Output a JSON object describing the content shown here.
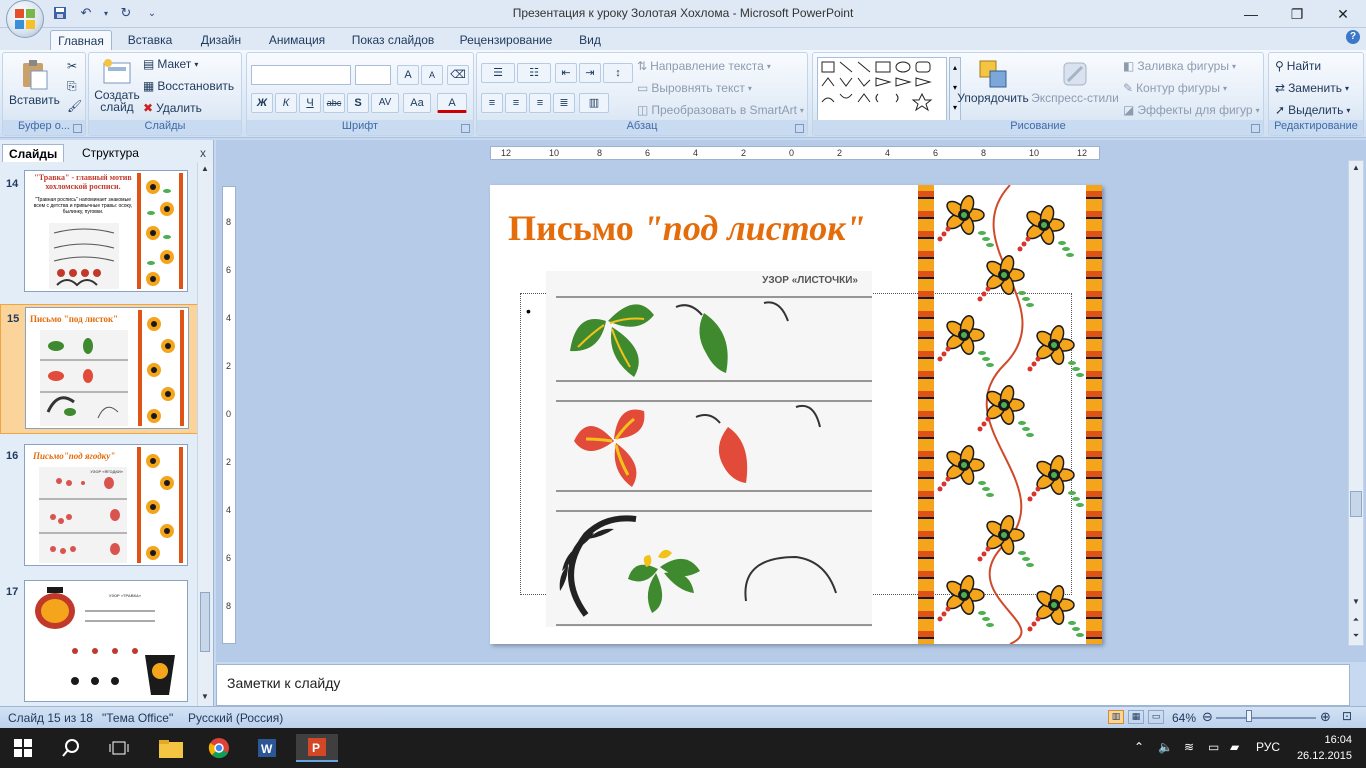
{
  "window": {
    "title": "Презентация к уроку Золотая Хохлома - Microsoft PowerPoint",
    "minimize": "—",
    "maximize": "❐",
    "close": "✕"
  },
  "qat": {
    "save_icon": "save-icon",
    "undo_icon": "undo-icon",
    "redo_icon": "redo-icon"
  },
  "tabs": [
    {
      "label": "Главная",
      "active": true
    },
    {
      "label": "Вставка"
    },
    {
      "label": "Дизайн"
    },
    {
      "label": "Анимация"
    },
    {
      "label": "Показ слайдов"
    },
    {
      "label": "Рецензирование"
    },
    {
      "label": "Вид"
    }
  ],
  "ribbon": {
    "clipboard": {
      "label": "Буфер о...",
      "paste": "Вставить"
    },
    "slides": {
      "label": "Слайды",
      "new_slide": "Создать слайд",
      "layout": "Макет",
      "reset": "Восстановить",
      "delete": "Удалить"
    },
    "font": {
      "label": "Шрифт",
      "bold": "Ж",
      "italic": "К",
      "underline": "Ч",
      "strike": "abc",
      "shadow": "S",
      "spacing": "AV",
      "case": "Aa",
      "color": "A",
      "grow": "A",
      "shrink": "A"
    },
    "paragraph": {
      "label": "Абзац",
      "text_direction": "Направление текста",
      "align_text": "Выровнять текст",
      "smartart": "Преобразовать в SmartArt"
    },
    "drawing": {
      "label": "Рисование",
      "arrange": "Упорядочить",
      "quick_styles": "Экспресс-стили",
      "fill": "Заливка фигуры",
      "outline": "Контур фигуры",
      "effects": "Эффекты для фигур"
    },
    "editing": {
      "label": "Редактирование",
      "find": "Найти",
      "replace": "Заменить",
      "select": "Выделить"
    }
  },
  "left_panel": {
    "tab_slides": "Слайды",
    "tab_outline": "Структура",
    "close": "x",
    "thumbnails": [
      {
        "num": "14",
        "title": "\"Травка\" - главный мотив хохломской росписи.",
        "text": "\"Травная роспись\" напоминает знакомые всем с детства и привычные травы: осоку, былинку, пуговки.",
        "selected": false
      },
      {
        "num": "15",
        "title": "Письмо \"под листок\"",
        "selected": true
      },
      {
        "num": "16",
        "title": "Письмо\"под ягодку\"",
        "caption": "УЗОР «ЯГОДКИ»",
        "selected": false
      },
      {
        "num": "17",
        "caption": "УЗОР «ТРАВКА»",
        "selected": false
      }
    ]
  },
  "slide": {
    "title_plain": "Письмо ",
    "title_italic": "\"под листок\"",
    "picture_caption": "УЗОР «ЛИСТОЧКИ»",
    "bullet": "•"
  },
  "ruler": {
    "h_ticks": [
      "12",
      "10",
      "8",
      "6",
      "4",
      "2",
      "0",
      "2",
      "4",
      "6",
      "8",
      "10",
      "12"
    ],
    "v_ticks": [
      "8",
      "6",
      "4",
      "2",
      "0",
      "2",
      "4",
      "6",
      "8"
    ]
  },
  "notes": {
    "placeholder": "Заметки к слайду"
  },
  "status": {
    "slide_of": "Слайд 15 из 18",
    "theme": "\"Тема Office\"",
    "language": "Русский (Россия)",
    "zoom": "64%"
  },
  "taskbar": {
    "language": "РУС",
    "time": "16:04",
    "date": "26.12.2015"
  },
  "colors": {
    "title_orange": "#e46c0a",
    "ribbon_label": "#3e6aa8",
    "leaf_green": "#3f8a2e",
    "leaf_red": "#e24a3a",
    "leaf_yellow": "#f2c21b"
  }
}
